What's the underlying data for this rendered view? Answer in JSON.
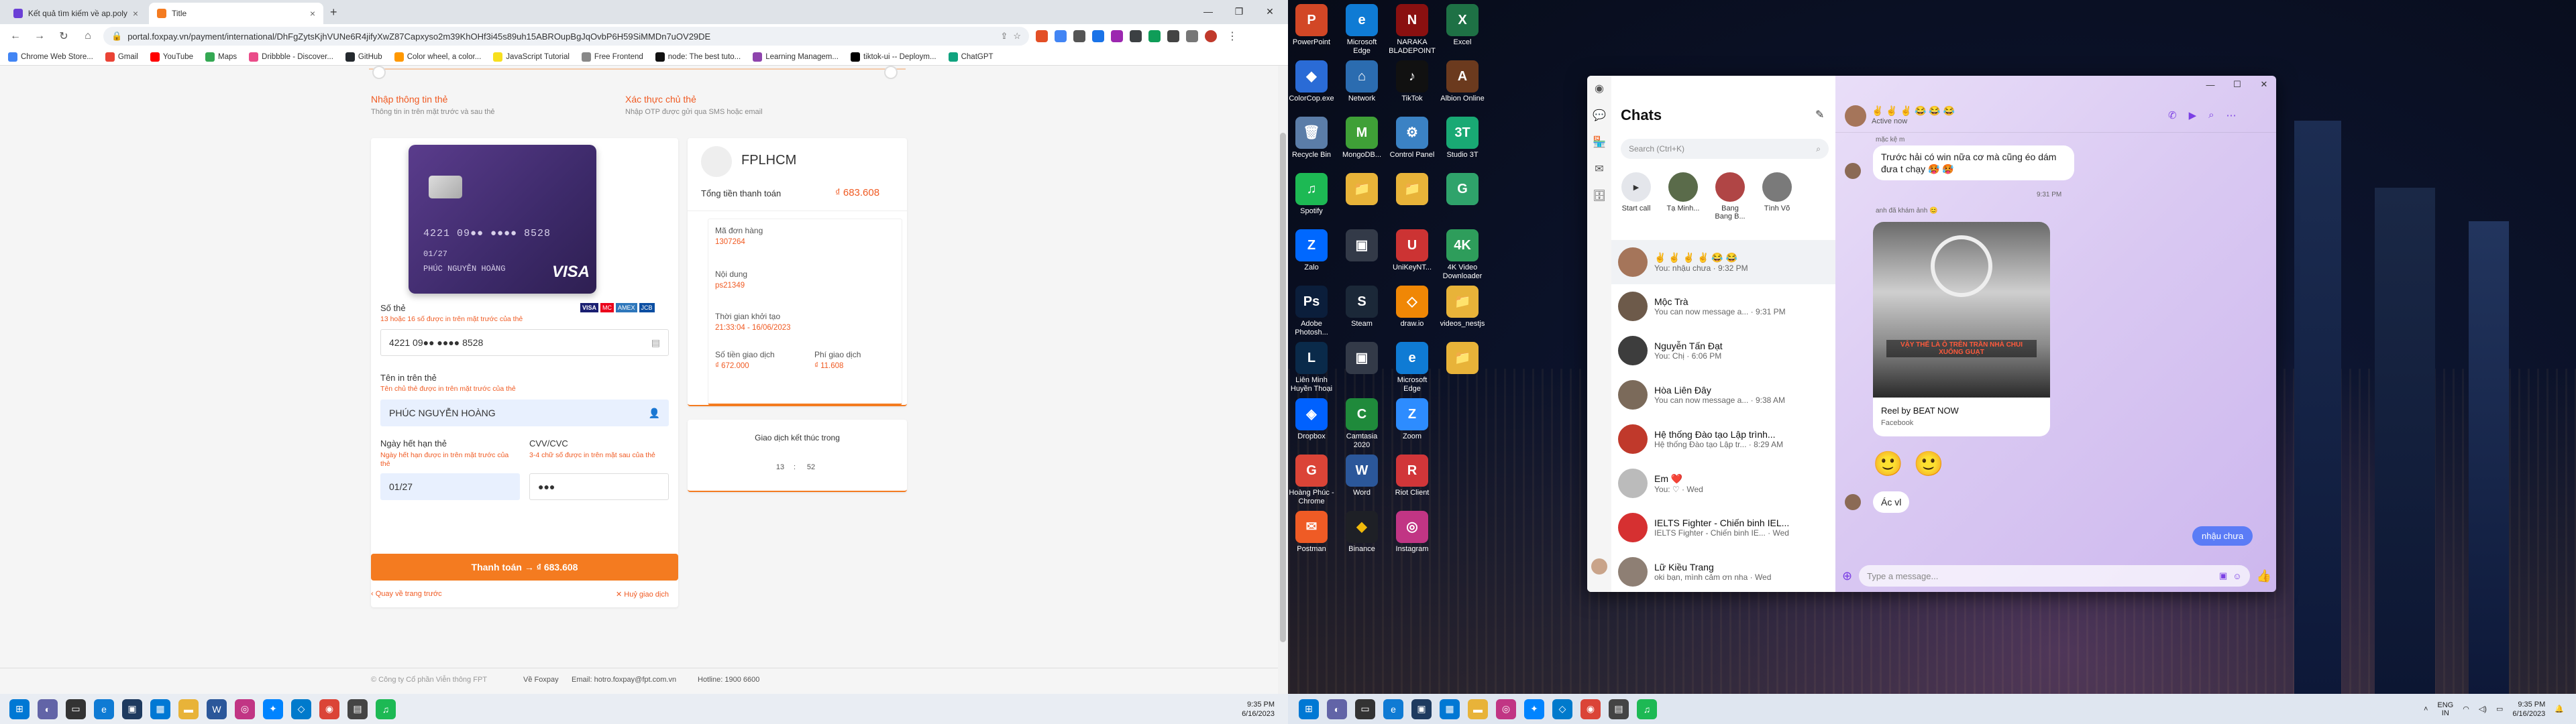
{
  "left": {
    "tabs": [
      {
        "label": "Kết quả tìm kiếm về ap.poly.edu..."
      },
      {
        "label": "Title"
      }
    ],
    "new_tab": "+",
    "window_controls": [
      "—",
      "❐",
      "✕"
    ],
    "url": "portal.foxpay.vn/payment/international/DhFgZytsKjhVUNe6R4jifyXwZ87Capxyso2m39KhOHf3i45s89uh15ABROupBgJqOvbP6H59SiMMDn7uOV29DE",
    "bookmarks": [
      "Chrome Web Store...",
      "Gmail",
      "YouTube",
      "Maps",
      "Dribbble - Discover...",
      "GitHub",
      "Color wheel, a color...",
      "JavaScript Tutorial",
      "Free Frontend",
      "node: The best tuto...",
      "Learning Managem...",
      "tiktok-ui -- Deploym...",
      "ChatGPT"
    ],
    "steps": [
      {
        "title": "Nhập thông tin thẻ",
        "sub": "Thông tin in trên mặt trước và sau thẻ"
      },
      {
        "title": "Xác thực chủ thẻ",
        "sub": "Nhập OTP được gửi qua SMS hoặc email"
      }
    ],
    "card_visual": {
      "number": "4221 09●● ●●●● 8528",
      "expiry": "01/27",
      "holder": "PHÚC NGUYỄN HOÀNG",
      "brand": "VISA"
    },
    "form": {
      "card_number_label": "Số thẻ",
      "card_number_hint": "13 hoặc 16 số được in trên mặt trước của thẻ",
      "card_number_value": "4221 09●● ●●●● 8528",
      "name_label": "Tên in trên thẻ",
      "name_hint": "Tên chủ thẻ được in trên mặt trước của thẻ",
      "name_value": "PHÚC NGUYỄN HOÀNG",
      "expiry_label": "Ngày hết hạn thẻ",
      "expiry_hint": "Ngày hết hạn được in trên mặt trước của thẻ",
      "expiry_value": "01/27",
      "cvv_label": "CVV/CVC",
      "cvv_hint": "3-4 chữ số được in trên mặt sau của thẻ",
      "cvv_value": "●●●",
      "card_brands": [
        "VISA",
        "MC",
        "AMEX",
        "JCB"
      ]
    },
    "pay_button": "Thanh toán   →   ₫ 683.608",
    "back_link": "Quay về trang trước",
    "cancel_link": "Huỷ giao dịch",
    "summary": {
      "merchant": "FPLHCM",
      "total_label": "Tổng tiền thanh toán",
      "total_value": "₫ 683.608",
      "order_label": "Mã đơn hàng",
      "order_value": "1307264",
      "content_label": "Nội dung",
      "content_value": "ps21349",
      "time_label": "Thời gian khởi tạo",
      "time_value": "21:33:04 - 16/06/2023",
      "amount_label": "Số tiền giao dịch",
      "amount_value": "₫ 672.000",
      "fee_label": "Phí giao dịch",
      "fee_value": "₫ 11.608"
    },
    "timer": {
      "label": "Giao dịch kết thúc trong",
      "minutes": "13",
      "sep": ":",
      "seconds": "52"
    },
    "footer": {
      "copyright": "© Công ty Cổ phần Viễn thông FPT",
      "about": "Về Foxpay",
      "email": "Email: hotro.foxpay@fpt.com.vn",
      "hotline": "Hotline: 1900 6600"
    },
    "clock": {
      "time": "9:35 PM",
      "date": "6/16/2023"
    }
  },
  "right": {
    "desktop_icons": [
      {
        "label": "PowerPoint",
        "color": "#d24726",
        "glyph": "P"
      },
      {
        "label": "Microsoft Edge",
        "color": "#0f7bd4",
        "glyph": "e"
      },
      {
        "label": "NARAKA BLADEPOINT",
        "color": "#8a1010",
        "glyph": "N"
      },
      {
        "label": "Excel",
        "color": "#1e7145",
        "glyph": "X"
      },
      {
        "label": "ColorCop.exe",
        "color": "#2a6bd6",
        "glyph": "◆"
      },
      {
        "label": "Network",
        "color": "#2b6cb0",
        "glyph": "⌂"
      },
      {
        "label": "TikTok",
        "color": "#111111",
        "glyph": "♪"
      },
      {
        "label": "Albion Online",
        "color": "#6b3a1e",
        "glyph": "A"
      },
      {
        "label": "Recycle Bin",
        "color": "#5b7da8",
        "glyph": "🗑"
      },
      {
        "label": "MongoDB...",
        "color": "#3fa037",
        "glyph": "M"
      },
      {
        "label": "Control Panel",
        "color": "#3b82c4",
        "glyph": "⚙"
      },
      {
        "label": "Studio 3T",
        "color": "#19a974",
        "glyph": "3T"
      },
      {
        "label": "Spotify",
        "color": "#1db954",
        "glyph": "♫"
      },
      {
        "label": "",
        "color": "#e8b339",
        "glyph": "📁"
      },
      {
        "label": "",
        "color": "#e8b339",
        "glyph": "📁"
      },
      {
        "label": "",
        "color": "#2fa36b",
        "glyph": "G"
      },
      {
        "label": "Zalo",
        "color": "#0068ff",
        "glyph": "Z"
      },
      {
        "label": "",
        "color": "#333a48",
        "glyph": "▣"
      },
      {
        "label": "UniKeyNT...",
        "color": "#c33",
        "glyph": "U"
      },
      {
        "label": "4K Video Downloader",
        "color": "#2e9d5b",
        "glyph": "4K"
      },
      {
        "label": "Adobe Photosh...",
        "color": "#0b1e3b",
        "glyph": "Ps"
      },
      {
        "label": "Steam",
        "color": "#1b2838",
        "glyph": "S"
      },
      {
        "label": "draw.io",
        "color": "#f08705",
        "glyph": "◇"
      },
      {
        "label": "videos_nestjs",
        "color": "#e8b339",
        "glyph": "📁"
      },
      {
        "label": "Liên Minh Huyền Thoại",
        "color": "#0a2a4a",
        "glyph": "L"
      },
      {
        "label": "",
        "color": "#333a48",
        "glyph": "▣"
      },
      {
        "label": "Microsoft Edge",
        "color": "#0f7bd4",
        "glyph": "e"
      },
      {
        "label": "",
        "color": "#e8b339",
        "glyph": "📁"
      },
      {
        "label": "Dropbox",
        "color": "#0061fe",
        "glyph": "◈"
      },
      {
        "label": "Camtasia 2020",
        "color": "#1f8a3b",
        "glyph": "C"
      },
      {
        "label": "Zoom",
        "color": "#2d8cff",
        "glyph": "Z"
      },
      {
        "label": "Hoàng Phúc - Chrome",
        "color": "#db4437",
        "glyph": "G"
      },
      {
        "label": "Word",
        "color": "#2b579a",
        "glyph": "W"
      },
      {
        "label": "Riot Client",
        "color": "#d13639",
        "glyph": "R"
      },
      {
        "label": "Postman",
        "color": "#ef5b25",
        "glyph": "✉"
      },
      {
        "label": "Binance",
        "color": "#1e2026",
        "glyph": "◆"
      },
      {
        "label": "Instagram",
        "color": "#c13584",
        "glyph": "◎"
      }
    ],
    "messenger": {
      "title": "Chats",
      "search_placeholder": "Search (Ctrl+K)",
      "stories": [
        {
          "name": "Start call"
        },
        {
          "name": "Tạ Minh..."
        },
        {
          "name": "Bang Bang B..."
        },
        {
          "name": "Tình Võ"
        }
      ],
      "chats": [
        {
          "name": "✌ ✌ ✌ ✌ 😂 😂",
          "preview": "You: nhậu chưa · 9:32 PM",
          "color": "#a5755a"
        },
        {
          "name": "Mộc Trà",
          "preview": "You can now message a... · 9:31 PM",
          "color": "#6d5a4a"
        },
        {
          "name": "Nguyễn Tấn Đạt",
          "preview": "You: Chị · 6:06 PM",
          "color": "#3d3d3d"
        },
        {
          "name": "Hòa Liên Đây",
          "preview": "You can now message a... · 9:38 AM",
          "color": "#7b6a5a"
        },
        {
          "name": "Hệ thống Đào tạo Lập trình...",
          "preview": "Hệ thống Đào tạo Lập tr... · 8:29 AM",
          "color": "#c0392b"
        },
        {
          "name": "Em ❤️",
          "preview": "You: ♡ · Wed",
          "color": "#bbbbbb"
        },
        {
          "name": "IELTS Fighter - Chiến binh IEL...",
          "preview": "IELTS Fighter - Chiến binh IE... · Wed",
          "color": "#d63031"
        },
        {
          "name": "Lữ Kiều Trang",
          "preview": "oki bạn, mình cảm ơn nha · Wed",
          "color": "#8e7f74"
        }
      ],
      "header_name": "✌ ✌ ✌ 😂 😂 😂",
      "header_status": "Active now",
      "msg_sender1": "mặc kệ m",
      "msg1": "Trước hải có win nữa cơ mà cũng éo dám đưa t chạy 🥵 🥵",
      "time1": "9:31 PM",
      "msg_sender2": "anh đã khám ảnh 😊",
      "reel_title": "Reel by BEAT NOW",
      "reel_source": "Facebook",
      "reel_caption": "VẬY THẾ LÀ Ô TRÊN TRẦN NHÀ CHUI XUỐNG GUẠT",
      "reactions": [
        "🙂",
        "🙂"
      ],
      "msg2": "Ác vl",
      "my_msg": "nhậu chưa",
      "input_placeholder": "Type a message..."
    },
    "tray": {
      "lang": "ENG\nIN",
      "time": "9:35 PM",
      "date": "6/16/2023"
    }
  }
}
